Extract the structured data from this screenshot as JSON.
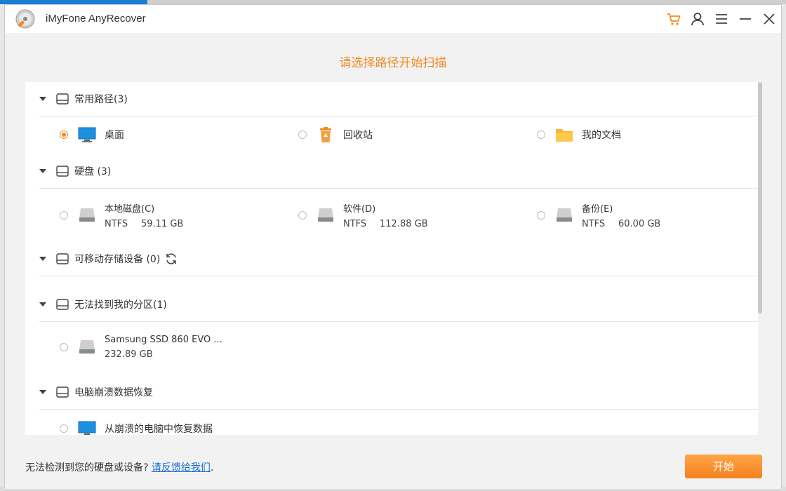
{
  "app": {
    "title": "iMyFone AnyRecover"
  },
  "titlebar": {
    "icons": [
      "cart-icon",
      "user-icon",
      "menu-icon",
      "minimize-icon",
      "close-icon"
    ]
  },
  "page_title": "请选择路径开始扫描",
  "sections": {
    "common": {
      "label": "常用路径(3)",
      "items": [
        {
          "label": "桌面",
          "icon": "desktop-monitor-icon",
          "selected": true
        },
        {
          "label": "回收站",
          "icon": "recycle-bin-icon",
          "selected": false
        },
        {
          "label": "我的文档",
          "icon": "folder-icon",
          "selected": false
        }
      ]
    },
    "disks": {
      "label": "硬盘 (3)",
      "items": [
        {
          "name": "本地磁盘(C)",
          "fs": "NTFS",
          "size": "59.11 GB"
        },
        {
          "name": "软件(D)",
          "fs": "NTFS",
          "size": "112.88 GB"
        },
        {
          "name": "备份(E)",
          "fs": "NTFS",
          "size": "60.00 GB"
        }
      ]
    },
    "removable": {
      "label": "可移动存储设备 (0)"
    },
    "lost_partition": {
      "label": "无法找到我的分区(1)",
      "items": [
        {
          "name": "Samsung SSD 860 EVO ...",
          "size": "232.89 GB"
        }
      ]
    },
    "crash": {
      "label": "电脑崩溃数据恢复",
      "items": [
        {
          "label": "从崩溃的电脑中恢复数据"
        }
      ]
    }
  },
  "footer": {
    "text": "无法检测到您的硬盘或设备? ",
    "link": "请反馈给我们",
    "suffix": ".",
    "start_label": "开始"
  },
  "colors": {
    "accent": "#f08a24",
    "link": "#1a6fd4"
  }
}
